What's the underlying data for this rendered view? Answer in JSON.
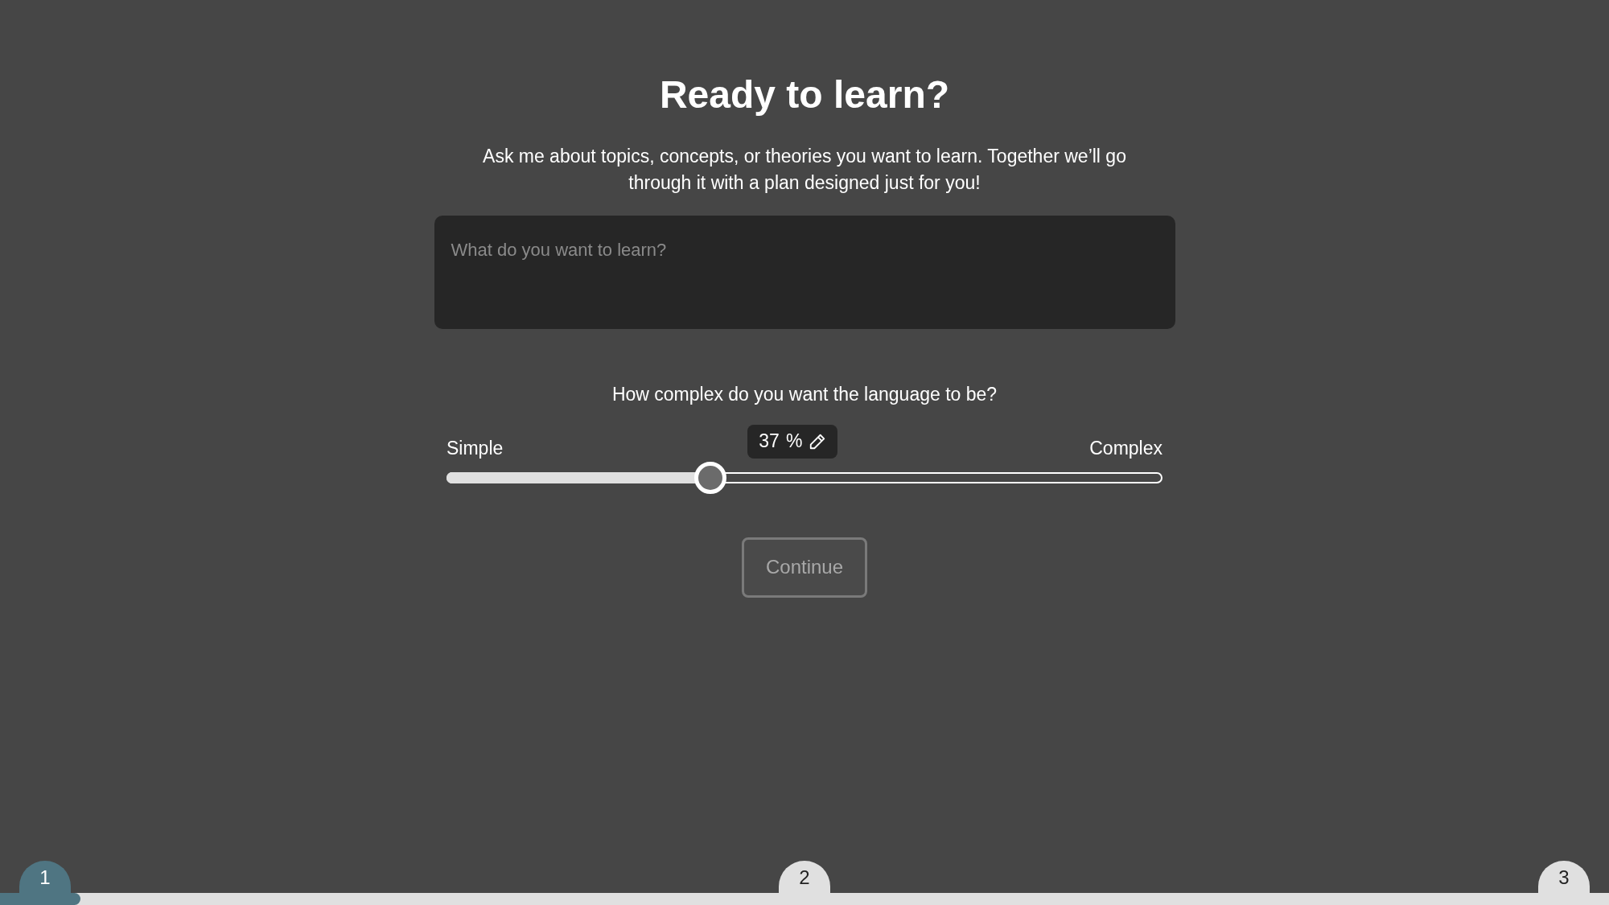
{
  "title": "Ready to learn?",
  "subtitle": "Ask me about topics, concepts, or theories you want to learn. Together we’ll go through it with a plan designed just for you!",
  "topic_field": {
    "placeholder": "What do you want to learn?"
  },
  "complexity": {
    "question": "How complex do you want the language to be?",
    "min_label": "Simple",
    "max_label": "Complex",
    "value": "37",
    "unit": "%",
    "level": 0.37
  },
  "continue_button": {
    "label": "Continue",
    "disabled": true
  },
  "progress": {
    "level": 0.05
  },
  "steps": [
    {
      "label": "1",
      "selected": true
    },
    {
      "label": "2",
      "selected": false
    },
    {
      "label": "3",
      "selected": false
    }
  ]
}
